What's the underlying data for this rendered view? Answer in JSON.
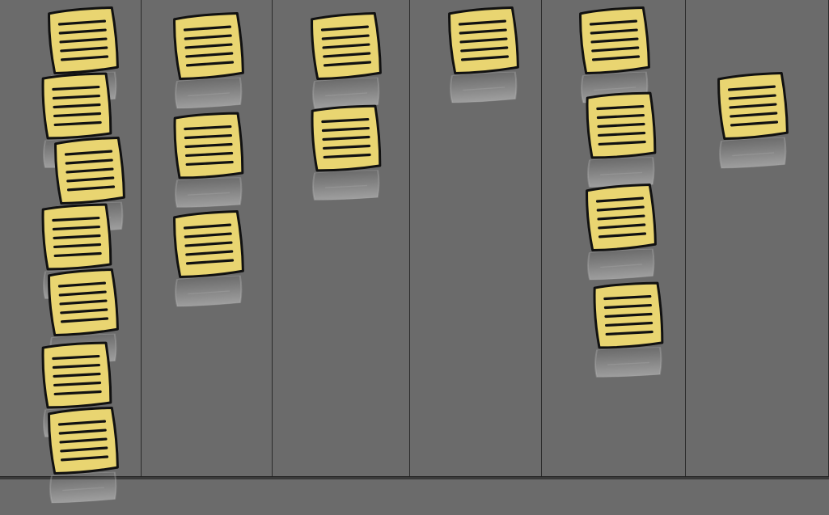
{
  "board": {
    "background_color": "#6b6b6b",
    "divider_color": "#2b2b2b",
    "note_fill_color": "#e9d571",
    "note_outline_color": "#111111",
    "note_icon": "sticky-note-icon",
    "columns": [
      {
        "note_count": 7
      },
      {
        "note_count": 3
      },
      {
        "note_count": 2
      },
      {
        "note_count": 1
      },
      {
        "note_count": 4
      },
      {
        "note_count": 1
      }
    ]
  }
}
